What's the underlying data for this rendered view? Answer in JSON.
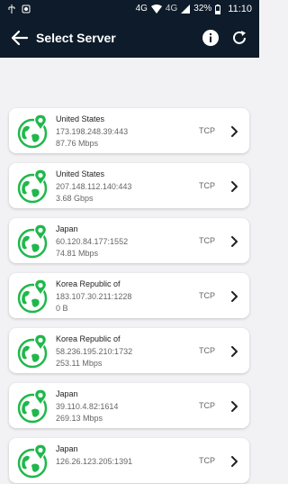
{
  "status": {
    "network_badge": "4G",
    "network_badge_2": "4G",
    "battery": "32%",
    "time": "11:10"
  },
  "header": {
    "title": "Select Server"
  },
  "servers": [
    {
      "country": "United States",
      "ip": "173.198.248.39:443",
      "speed": "87.76 Mbps",
      "protocol": "TCP"
    },
    {
      "country": "United States",
      "ip": "207.148.112.140:443",
      "speed": "3.68 Gbps",
      "protocol": "TCP"
    },
    {
      "country": "Japan",
      "ip": "60.120.84.177:1552",
      "speed": "74.81 Mbps",
      "protocol": "TCP"
    },
    {
      "country": "Korea Republic of",
      "ip": "183.107.30.211:1228",
      "speed": "0 B",
      "protocol": "TCP"
    },
    {
      "country": "Korea Republic of",
      "ip": "58.236.195.210:1732",
      "speed": "253.11 Mbps",
      "protocol": "TCP"
    },
    {
      "country": "Japan",
      "ip": "39.110.4.82:1614",
      "speed": "269.13 Mbps",
      "protocol": "TCP"
    },
    {
      "country": "Japan",
      "ip": "126.26.123.205:1391",
      "speed": "",
      "protocol": "TCP"
    }
  ],
  "icons": {
    "server": "globe-pin-icon",
    "back": "arrow-left-icon",
    "info": "info-icon",
    "refresh": "refresh-icon",
    "chevron": "chevron-right-icon"
  },
  "colors": {
    "appbar": "#0d1b2a",
    "globe": "#1fb84b",
    "background": "#f2f2f4"
  }
}
